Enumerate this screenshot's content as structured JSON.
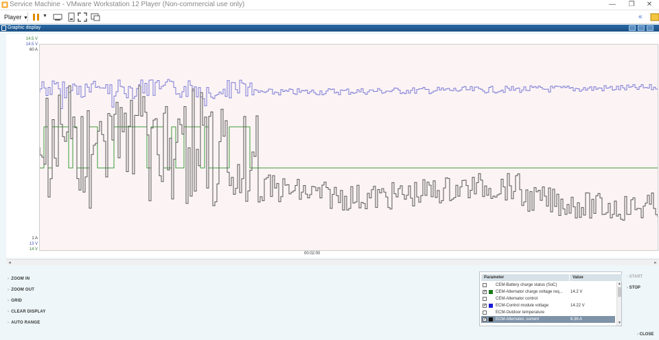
{
  "window": {
    "title": "Service Machine - VMware Workstation 12 Player (Non-commercial use only)",
    "player_label": "Player",
    "app_title": "Graphic display"
  },
  "axes": {
    "left_top": [
      {
        "text": "14.5 V",
        "color": "#2e7d32"
      },
      {
        "text": "14.5 V",
        "color": "#3f51b5"
      },
      {
        "text": "60 A",
        "color": "#333333"
      }
    ],
    "left_bottom": [
      {
        "text": "1 A",
        "color": "#333333"
      },
      {
        "text": "13 V",
        "color": "#3f51b5"
      },
      {
        "text": "14 V",
        "color": "#2e7d32"
      }
    ],
    "time_label": "00:02:00"
  },
  "commands": {
    "zoom_in": "ZOOM IN",
    "zoom_out": "ZOOM OUT",
    "grid": "GRID",
    "clear_display": "CLEAR DISPLAY",
    "auto_range": "AUTO RANGE"
  },
  "table": {
    "header_parameter": "Parameter",
    "header_value": "Value",
    "rows": [
      {
        "name": "CEM-Battery charge status (SoC)",
        "value": "",
        "checked": false,
        "color": ""
      },
      {
        "name": "CEM-Alternator charge voltage req...",
        "value": "14.2 V",
        "checked": true,
        "color": "#1b7a1b"
      },
      {
        "name": "CEM-Alternator control",
        "value": "",
        "checked": false,
        "color": ""
      },
      {
        "name": "ECM-Control module voltage",
        "value": "14.22 V",
        "checked": true,
        "color": "#1a1adb"
      },
      {
        "name": "ECM-Outdoor temperature",
        "value": "",
        "checked": false,
        "color": ""
      },
      {
        "name": "ECM-Alternator, current",
        "value": "8.36 A",
        "checked": true,
        "color": "#111111",
        "selected": true
      }
    ]
  },
  "side": {
    "start": "START",
    "stop": "STOP",
    "close": "CLOSE"
  },
  "colors": {
    "voltage_series": "#7a7ad6",
    "charge_request_series": "#3a9a3a",
    "current_series": "#555555"
  }
}
